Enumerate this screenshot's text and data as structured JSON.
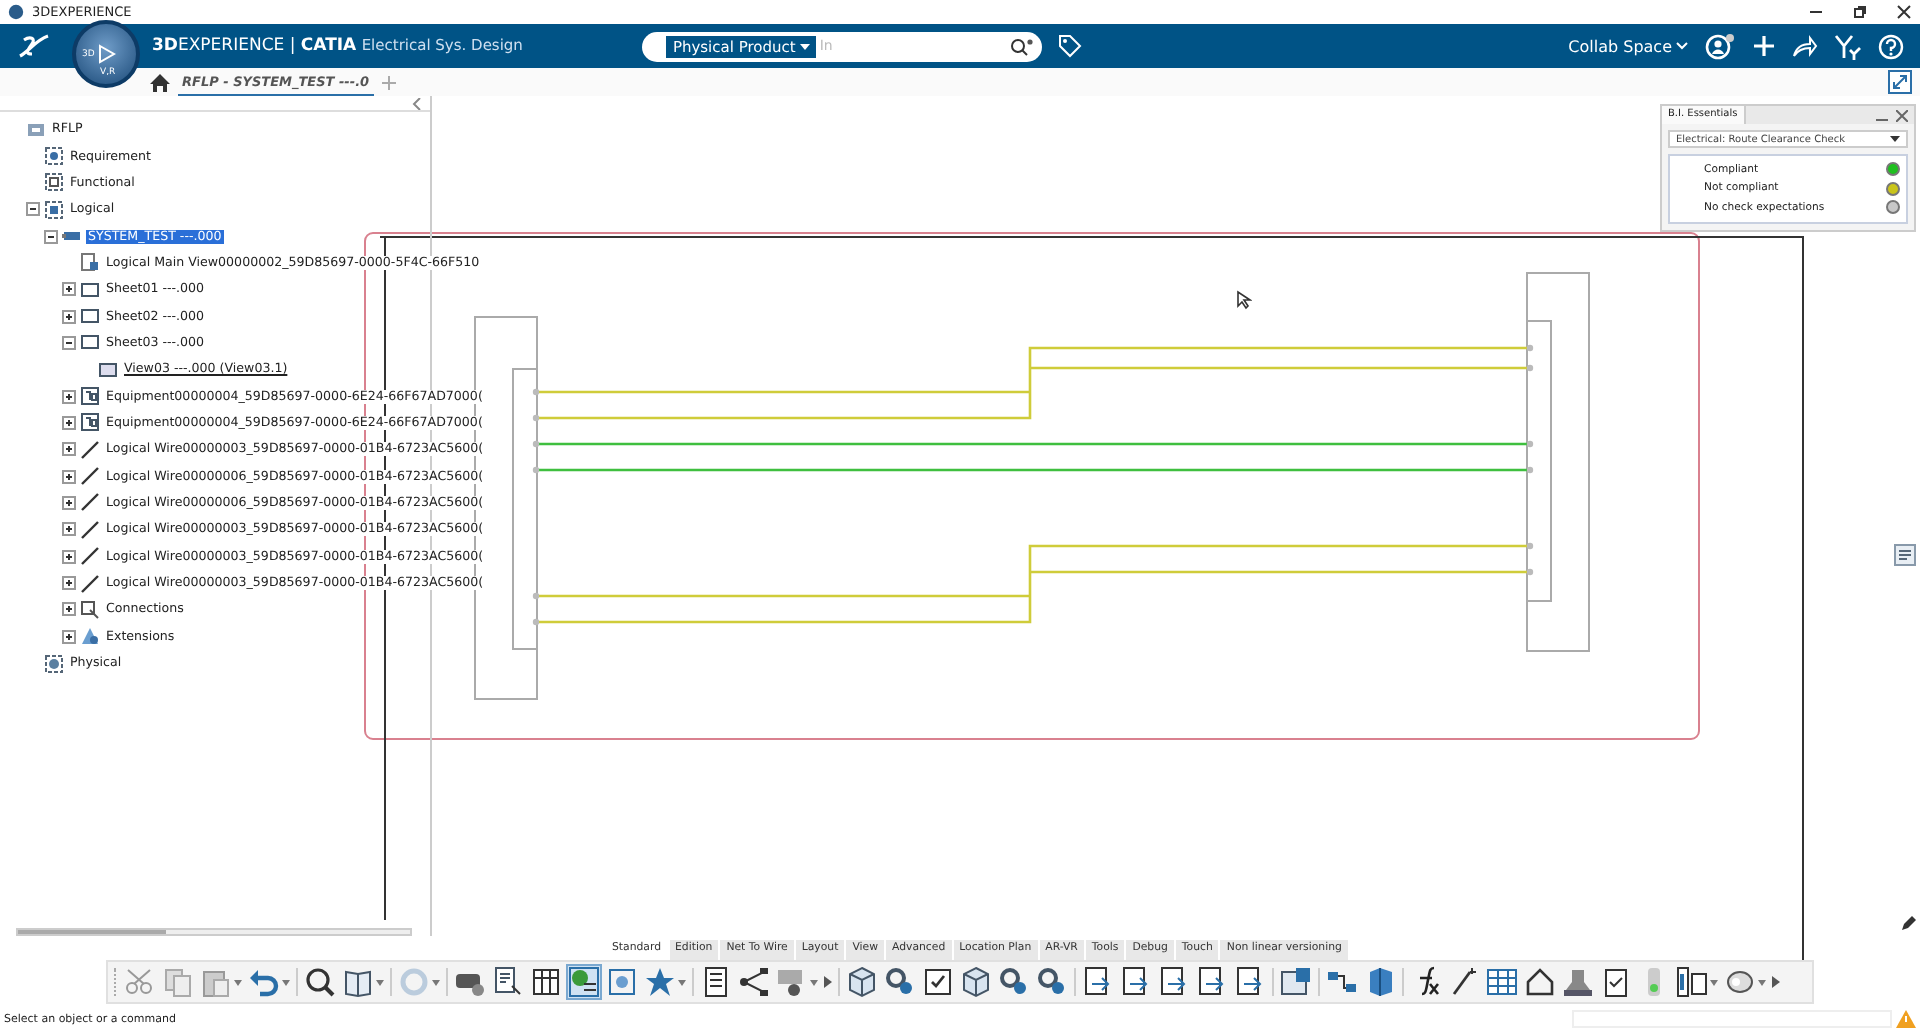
{
  "window": {
    "title": "3DEXPERIENCE"
  },
  "header": {
    "brand_bold": "3D",
    "brand_rest": "EXPERIENCE",
    "separator": "|",
    "app": "CATIA",
    "role": "Electrical Sys. Design",
    "compass_labels": [
      "3D",
      "V,R"
    ],
    "search_scope": "Physical Product",
    "search_placeholder": "In",
    "collab_space": "Collab Space"
  },
  "tabs": [
    {
      "label": "RFLP - SYSTEM_TEST ---.0",
      "selected": true
    }
  ],
  "tree": [
    {
      "label": "RFLP",
      "kind": "root",
      "selected": false,
      "children": [
        {
          "label": "Requirement",
          "kind": "requirement",
          "selected": false
        },
        {
          "label": "Functional",
          "kind": "functional",
          "selected": false
        },
        {
          "label": "Logical",
          "kind": "logical",
          "selected": false,
          "expanded": true,
          "children": [
            {
              "label": "SYSTEM_TEST ---.000",
              "kind": "system",
              "selected": true,
              "expanded": true,
              "children": [
                {
                  "label": "Logical Main View00000002_59D85697-0000-5F4C-66F510",
                  "kind": "mainview",
                  "selected": false
                },
                {
                  "label": "Sheet01 ---.000",
                  "kind": "sheet",
                  "selected": false,
                  "expanded": false
                },
                {
                  "label": "Sheet02 ---.000",
                  "kind": "sheet",
                  "selected": false,
                  "expanded": false
                },
                {
                  "label": "Sheet03 ---.000",
                  "kind": "sheet",
                  "selected": false,
                  "expanded": true,
                  "children": [
                    {
                      "label": "View03 ---.000 (View03.1)",
                      "kind": "view",
                      "selected": false,
                      "current": true
                    }
                  ]
                },
                {
                  "label": "Equipment00000004_59D85697-0000-6E24-66F67AD7000(",
                  "kind": "equipment",
                  "selected": false,
                  "expanded": false
                },
                {
                  "label": "Equipment00000004_59D85697-0000-6E24-66F67AD7000(",
                  "kind": "equipment",
                  "selected": false,
                  "expanded": false
                },
                {
                  "label": "Logical Wire00000003_59D85697-0000-01B4-6723AC5600(",
                  "kind": "wire",
                  "selected": false,
                  "expanded": false
                },
                {
                  "label": "Logical Wire00000006_59D85697-0000-01B4-6723AC5600(",
                  "kind": "wire",
                  "selected": false,
                  "expanded": false
                },
                {
                  "label": "Logical Wire00000006_59D85697-0000-01B4-6723AC5600(",
                  "kind": "wire",
                  "selected": false,
                  "expanded": false
                },
                {
                  "label": "Logical Wire00000003_59D85697-0000-01B4-6723AC5600(",
                  "kind": "wire",
                  "selected": false,
                  "expanded": false
                },
                {
                  "label": "Logical Wire00000003_59D85697-0000-01B4-6723AC5600(",
                  "kind": "wire",
                  "selected": false,
                  "expanded": false
                },
                {
                  "label": "Logical Wire00000003_59D85697-0000-01B4-6723AC5600(",
                  "kind": "wire",
                  "selected": false,
                  "expanded": false
                },
                {
                  "label": "Connections",
                  "kind": "connections",
                  "selected": false,
                  "expanded": false
                },
                {
                  "label": "Extensions",
                  "kind": "extensions",
                  "selected": false,
                  "expanded": false
                }
              ]
            }
          ]
        },
        {
          "label": "Physical",
          "kind": "physical",
          "selected": false
        }
      ]
    }
  ],
  "widget": {
    "title": "B.I. Essentials",
    "check": "Electrical: Route Clearance Check",
    "legend": [
      {
        "label": "Compliant",
        "color": "#1fbf1f"
      },
      {
        "label": "Not compliant",
        "color": "#c9c41a"
      },
      {
        "label": "No check expectations",
        "color": "#c8c8c8"
      }
    ]
  },
  "toolbar_tabs": [
    {
      "label": "Standard",
      "selected": true
    },
    {
      "label": "Edition",
      "selected": false
    },
    {
      "label": "Net To Wire",
      "selected": false
    },
    {
      "label": "Layout",
      "selected": false
    },
    {
      "label": "View",
      "selected": false
    },
    {
      "label": "Advanced",
      "selected": false
    },
    {
      "label": "Location Plan",
      "selected": false
    },
    {
      "label": "AR-VR",
      "selected": false
    },
    {
      "label": "Tools",
      "selected": false
    },
    {
      "label": "Debug",
      "selected": false
    },
    {
      "label": "Touch",
      "selected": false
    },
    {
      "label": "Non linear versioning",
      "selected": false
    }
  ],
  "status_bar": {
    "message": "Select an object or a command"
  }
}
